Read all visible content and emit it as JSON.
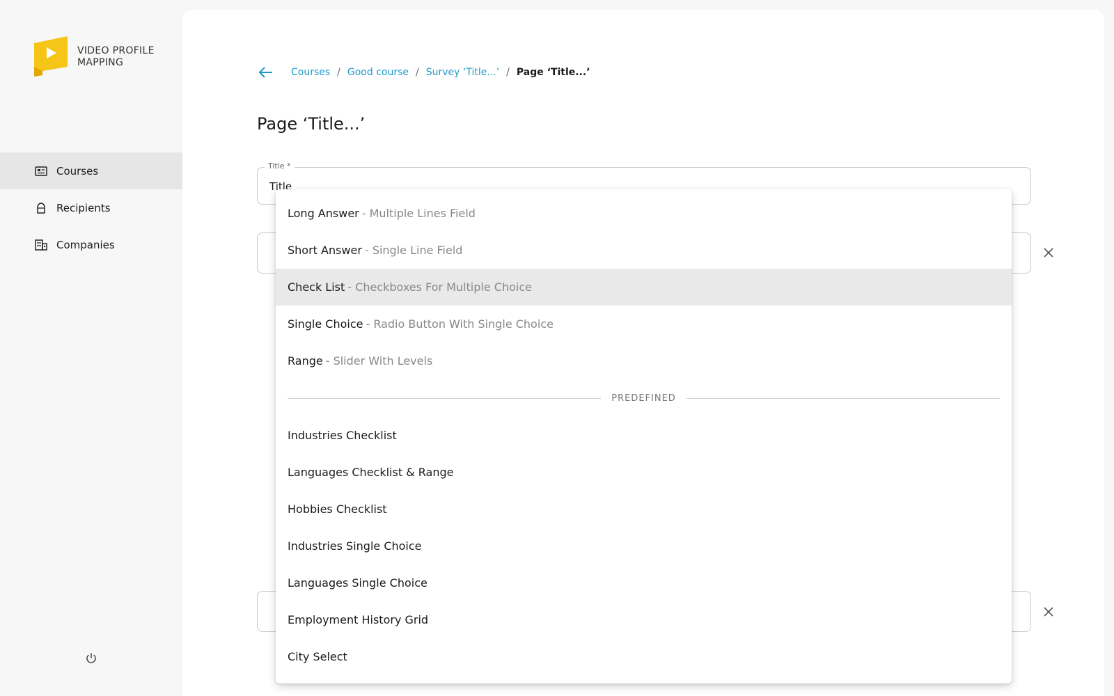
{
  "app": {
    "logo_line1": "VIDEO PROFILE",
    "logo_line2": "MAPPING",
    "brand_color": "#f5c518"
  },
  "sidebar": {
    "items": [
      {
        "label": "Courses",
        "icon": "courses-icon",
        "active": true
      },
      {
        "label": "Recipients",
        "icon": "recipients-icon",
        "active": false
      },
      {
        "label": "Companies",
        "icon": "companies-icon",
        "active": false
      }
    ],
    "logout_icon": "power-icon"
  },
  "breadcrumb": {
    "items": [
      "Courses",
      "Good course",
      "Survey ‘Title...’"
    ],
    "current": "Page ‘Title...’",
    "separator": "/"
  },
  "page": {
    "title": "Page ‘Title...’"
  },
  "form": {
    "title_label": "Title *",
    "title_value": "Title"
  },
  "dropdown": {
    "options": [
      {
        "name": "Long Answer",
        "desc": "- Multiple Lines Field"
      },
      {
        "name": "Short Answer",
        "desc": "- Single Line Field"
      },
      {
        "name": "Check List",
        "desc": "- Checkboxes For Multiple Choice",
        "highlighted": true
      },
      {
        "name": "Single Choice",
        "desc": "- Radio Button With Single Choice"
      },
      {
        "name": "Range",
        "desc": "- Slider With Levels"
      }
    ],
    "divider_label": "PREDEFINED",
    "predefined": [
      "Industries Checklist",
      "Languages Checklist & Range",
      "Hobbies Checklist",
      "Industries Single Choice",
      "Languages Single Choice",
      "Employment History Grid",
      "City Select"
    ]
  },
  "colors": {
    "link": "#1a9ac9",
    "highlight": "#e9e9e9",
    "sidebar_active": "#e6e6e6"
  }
}
